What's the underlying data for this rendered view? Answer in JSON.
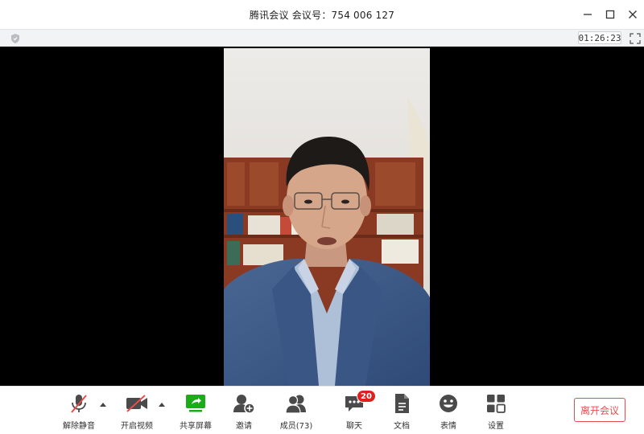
{
  "window": {
    "title": "腾讯会议 会议号：754 006 127"
  },
  "infobar": {
    "timer": "01:26:23",
    "security_icon": "shield-icon",
    "fullscreen_icon": "fullscreen-icon"
  },
  "toolbar": {
    "items": [
      {
        "label": "解除静音",
        "icon": "microphone-muted-icon"
      },
      {
        "label": "开启视频",
        "icon": "camera-off-icon"
      },
      {
        "label": "共享屏幕",
        "icon": "share-screen-icon"
      },
      {
        "label": "邀请",
        "icon": "invite-user-icon"
      },
      {
        "label": "成员(73)",
        "icon": "members-icon"
      },
      {
        "label": "聊天",
        "icon": "chat-icon",
        "badge": "20"
      },
      {
        "label": "文档",
        "icon": "document-icon"
      },
      {
        "label": "表情",
        "icon": "emoji-icon"
      },
      {
        "label": "设置",
        "icon": "settings-icon"
      }
    ],
    "leave_label": "离开会议"
  },
  "colors": {
    "accent_red": "#e54d4d",
    "badge_red": "#e02020",
    "share_green": "#1aad19",
    "icon_gray": "#4a4a4a"
  }
}
